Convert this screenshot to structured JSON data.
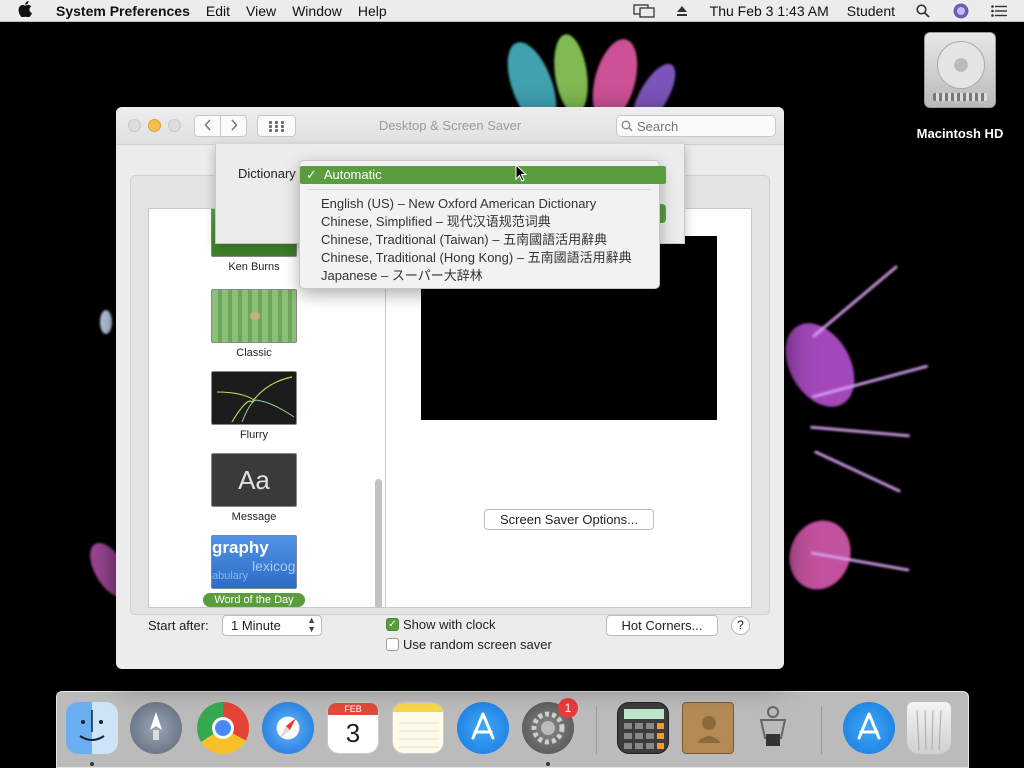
{
  "menubar": {
    "app_name": "System Preferences",
    "menus": [
      "Edit",
      "View",
      "Window",
      "Help"
    ],
    "datetime": "Thu Feb 3  1:43 AM",
    "user": "Student"
  },
  "desktop": {
    "hd_label": "Macintosh HD"
  },
  "window": {
    "title": "Desktop & Screen Saver",
    "search_placeholder": "Search"
  },
  "sheet": {
    "dictionary_label": "Dictionary",
    "selected_option": "Automatic",
    "options": [
      "English (US) – New Oxford American Dictionary",
      "Chinese, Simplified – 现代汉语规范词典",
      "Chinese, Traditional (Taiwan) – 五南國語活用辭典",
      "Chinese, Traditional (Hong Kong) – 五南國語活用辭典",
      "Japanese – スーパー大辞林"
    ]
  },
  "screensavers": [
    {
      "label": "Ken Burns",
      "thumb_color": "#4f9a3a"
    },
    {
      "label": "Classic",
      "thumb_color": "#7fb56e"
    },
    {
      "label": "Flurry",
      "thumb_color": "#2a2a2a"
    },
    {
      "label": "Message",
      "thumb_color": "#333333"
    },
    {
      "label": "Word of the Day",
      "thumb_color": "#3d7fd6",
      "selected": true
    }
  ],
  "thumb_text": {
    "message": "Aa",
    "wotd_1": "graphy",
    "wotd_2": "lexicog",
    "wotd_3": "abulary"
  },
  "options_button": "Screen Saver Options...",
  "bottom": {
    "start_after_label": "Start after:",
    "start_after_value": "1 Minute",
    "show_clock_label": "Show with clock",
    "show_clock_checked": true,
    "random_label": "Use random screen saver",
    "random_checked": false,
    "hot_corners": "Hot Corners...",
    "help": "?"
  },
  "dock": {
    "calendar_month": "FEB",
    "calendar_day": "3",
    "sysprefs_badge": "1",
    "items": [
      "finder-icon",
      "launchpad-icon",
      "chrome-icon",
      "safari-icon",
      "calendar-icon",
      "notes-icon",
      "app-store-icon",
      "system-preferences-icon",
      "calculator-icon",
      "contacts-icon",
      "system-information-icon",
      "downloads-app-store-icon",
      "trash-icon"
    ]
  },
  "colors": {
    "accent_green": "#5a9d3f",
    "badge_red": "#ea3b3b"
  }
}
